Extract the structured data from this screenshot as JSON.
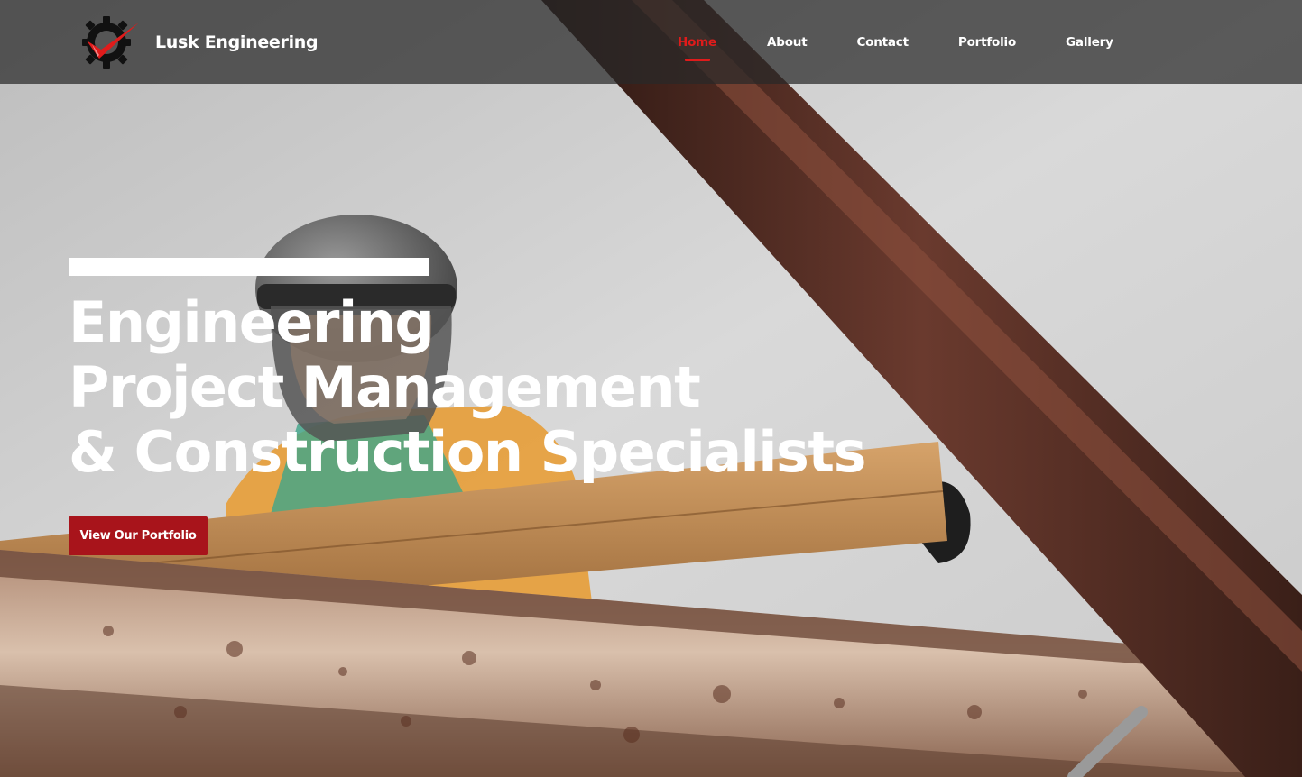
{
  "header": {
    "brand_name": "Lusk Engineering",
    "logo_icon": "gear-checkmark-logo",
    "nav": [
      {
        "label": "Home",
        "active": true
      },
      {
        "label": "About",
        "active": false
      },
      {
        "label": "Contact",
        "active": false
      },
      {
        "label": "Portfolio",
        "active": false
      },
      {
        "label": "Gallery",
        "active": false
      }
    ]
  },
  "hero": {
    "title_lines": [
      "Engineering",
      "Project Management",
      "& Construction Specialists"
    ],
    "cta_label": "View Our Portfolio"
  },
  "colors": {
    "accent_red": "#e01b1b",
    "button_red": "#a8141b",
    "header_bg": "#282828"
  }
}
